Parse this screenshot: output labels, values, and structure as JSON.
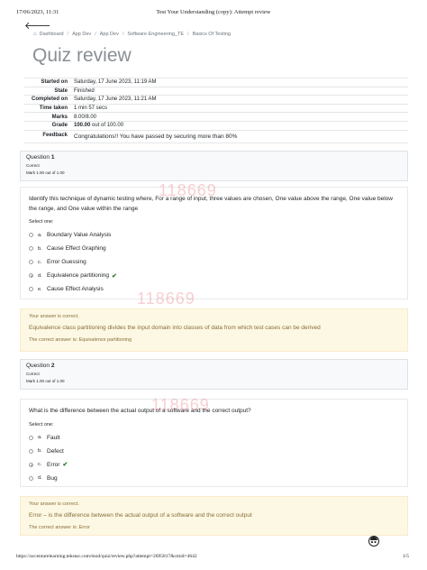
{
  "print_header": {
    "datetime": "17/06/2023, 11:31",
    "title": "Test Your Understanding (copy): Attempt review"
  },
  "breadcrumb": [
    "Dashboard",
    "App Dev",
    "App Dev",
    "Software Engineering_TE",
    "Basics Of Testing"
  ],
  "page_title": "Quiz review",
  "summary": [
    {
      "label": "Started on",
      "value": "Saturday, 17 June 2023, 11:19 AM"
    },
    {
      "label": "State",
      "value": "Finished"
    },
    {
      "label": "Completed on",
      "value": "Saturday, 17 June 2023, 11:21 AM"
    },
    {
      "label": "Time taken",
      "value": "1 min 57 secs"
    },
    {
      "label": "Marks",
      "value": "8.00/8.00"
    },
    {
      "label": "Grade",
      "value_bold": "100.00",
      "value_rest": " out of 100.00"
    },
    {
      "label": "Feedback",
      "value": "Congratulations!! You have passed by securing more than 80%"
    }
  ],
  "watermark": "118669",
  "select_one_label": "Select one:",
  "questions": [
    {
      "label": "Question",
      "number": "1",
      "state": "Correct",
      "mark": "Mark 1.00 out of 1.00",
      "text": "Identify this technique of dynamic testing where, For a range of input, three values are chosen, One value above the range, One value below the range, and One value within the range",
      "options": [
        {
          "letter": "a.",
          "text": "Boundary Value Analysis"
        },
        {
          "letter": "b.",
          "text": "Cause Effect Graphing"
        },
        {
          "letter": "c.",
          "text": "Error Guessing"
        },
        {
          "letter": "d.",
          "text": "Equivalence partitioning"
        },
        {
          "letter": "e.",
          "text": "Cause Effect Analysis"
        }
      ],
      "selected_index": 3,
      "outcome_msg": "Your answer is correct.",
      "feedback": "Equivalence class partitioning divides the input domain into classes of data from which test cases can be derived",
      "right_answer": "The correct answer is: Equivalence partitioning"
    },
    {
      "label": "Question",
      "number": "2",
      "state": "Correct",
      "mark": "Mark 1.00 out of 1.00",
      "text": "What is the difference between the actual output of a software and the correct output?",
      "options": [
        {
          "letter": "a.",
          "text": "Fault"
        },
        {
          "letter": "b.",
          "text": "Defect"
        },
        {
          "letter": "c.",
          "text": "Error"
        },
        {
          "letter": "d.",
          "text": "Bug"
        }
      ],
      "selected_index": 2,
      "outcome_msg": "Your answer is correct.",
      "feedback": "Error – is the difference between the actual output of a software and the correct output",
      "right_answer": "The correct answer is: Error"
    }
  ],
  "print_footer": {
    "url": "https://accenturelearning.tekstac.com/mod/quiz/review.php?attempt=2695817&cmid=4642",
    "page": "1/5"
  },
  "colors": {
    "correct_tick": "#357a32",
    "outcome_bg": "#fcf8e3",
    "outcome_text": "#8a6d3b",
    "watermark": "#e6505a"
  }
}
